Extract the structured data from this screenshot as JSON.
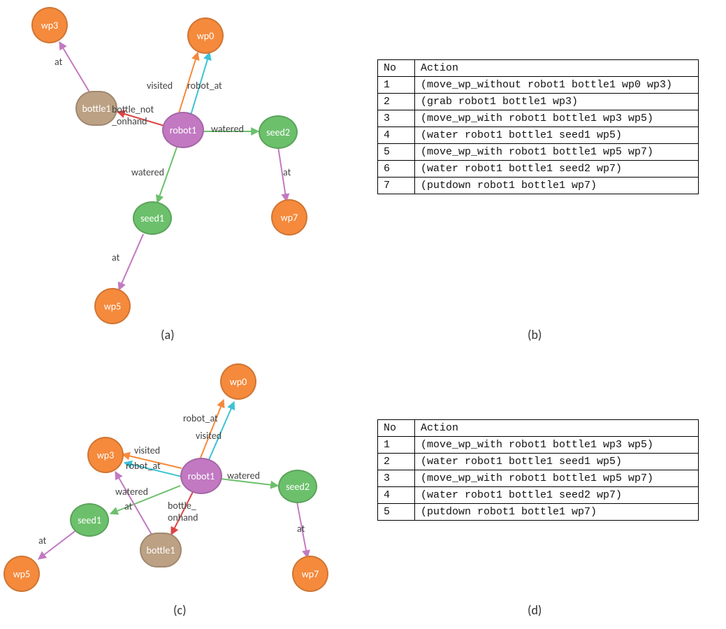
{
  "captions": {
    "a": "(a)",
    "b": "(b)",
    "c": "(c)",
    "d": "(d)"
  },
  "headers": {
    "no": "No",
    "action": "Action"
  },
  "graph_a": {
    "nodes": {
      "wp3": {
        "label": "wp3"
      },
      "wp0": {
        "label": "wp0"
      },
      "bottle1": {
        "label": "bottle1"
      },
      "robot1": {
        "label": "robot1"
      },
      "seed2": {
        "label": "seed2"
      },
      "seed1": {
        "label": "seed1"
      },
      "wp7": {
        "label": "wp7"
      },
      "wp5": {
        "label": "wp5"
      }
    },
    "edge_labels": {
      "at_wp3": "at",
      "visited": "visited",
      "robot_at": "robot_at",
      "bottle_not_onhand": "bottle_not\n_onhand",
      "watered_seed2": "watered",
      "watered_seed1": "watered",
      "at_wp7": "at",
      "at_wp5": "at"
    }
  },
  "graph_c": {
    "nodes": {
      "wp0": {
        "label": "wp0"
      },
      "wp3": {
        "label": "wp3"
      },
      "robot1": {
        "label": "robot1"
      },
      "seed2": {
        "label": "seed2"
      },
      "seed1": {
        "label": "seed1"
      },
      "bottle1": {
        "label": "bottle1"
      },
      "wp7": {
        "label": "wp7"
      },
      "wp5": {
        "label": "wp5"
      }
    },
    "edge_labels": {
      "robot_at_wp0": "robot_at",
      "visited_wp0": "visited",
      "visited_wp3": "visited",
      "robot_at_wp3": "robot_at",
      "watered_seed1": "watered",
      "at_seed1": "at",
      "bottle_onhand": "bottle_\nonhand",
      "watered_seed2": "watered",
      "at_wp7": "at",
      "at_wp5": "at"
    }
  },
  "plan_b": {
    "rows": [
      {
        "no": "1",
        "action": "(move_wp_without robot1 bottle1 wp0 wp3)"
      },
      {
        "no": "2",
        "action": "(grab robot1 bottle1 wp3)"
      },
      {
        "no": "3",
        "action": "(move_wp_with robot1 bottle1 wp3 wp5)"
      },
      {
        "no": "4",
        "action": "(water robot1 bottle1 seed1 wp5)"
      },
      {
        "no": "5",
        "action": "(move_wp_with robot1 bottle1 wp5 wp7)"
      },
      {
        "no": "6",
        "action": "(water robot1 bottle1 seed2 wp7)"
      },
      {
        "no": "7",
        "action": "(putdown robot1 bottle1 wp7)"
      }
    ]
  },
  "plan_d": {
    "rows": [
      {
        "no": "1",
        "action": "(move_wp_with robot1 bottle1 wp3 wp5)"
      },
      {
        "no": "2",
        "action": "(water robot1 bottle1 seed1 wp5)"
      },
      {
        "no": "3",
        "action": "(move_wp_with robot1 bottle1 wp5 wp7)"
      },
      {
        "no": "4",
        "action": "(water robot1 bottle1 seed2 wp7)"
      },
      {
        "no": "5",
        "action": "(putdown robot1 bottle1 wp7)"
      }
    ]
  }
}
